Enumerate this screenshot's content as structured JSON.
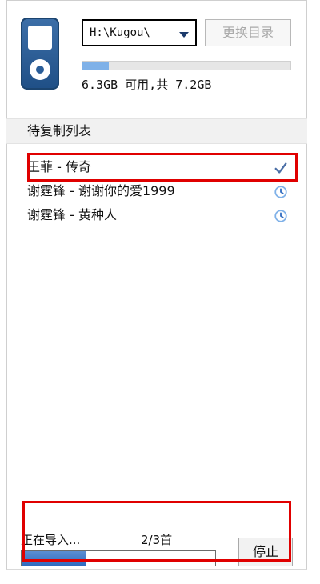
{
  "device": {
    "icon": "music-player-icon",
    "path": {
      "value": "H:\\Kugou\\"
    },
    "change_dir_button": "更换目录",
    "storage": {
      "text": "6.3GB 可用,共 7.2GB",
      "used_fraction": 0.125
    }
  },
  "list": {
    "header": "待复制列表",
    "items": [
      {
        "title": "王菲 - 传奇",
        "status_icon": "checkmark-icon"
      },
      {
        "title": "谢霆锋 - 谢谢你的爱1999",
        "status_icon": "clock-icon"
      },
      {
        "title": "谢霆锋 - 黄种人",
        "status_icon": "clock-icon"
      }
    ]
  },
  "import": {
    "label": "正在导入...",
    "count": "2/3首",
    "progress_fraction": 0.33,
    "stop_button": "停止"
  },
  "colors": {
    "highlight": "#e00000",
    "accent": "#2f6bc0",
    "icon_blue": "#2a5d98"
  }
}
